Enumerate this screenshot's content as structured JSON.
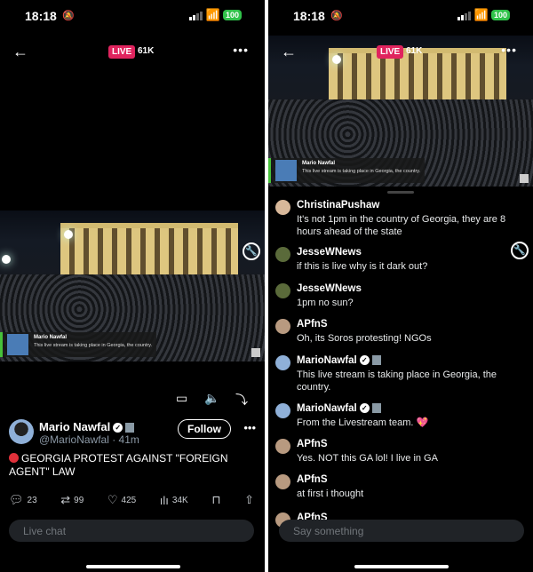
{
  "status": {
    "time": "18:18",
    "battery": "100"
  },
  "left": {
    "nav": {
      "live_label": "LIVE",
      "viewers": "61K"
    },
    "video_overlay": {
      "name": "Mario Nawfal",
      "text": "This live stream is taking place in Georgia, the country."
    },
    "author": {
      "name": "Mario Nawfal",
      "handle": "@MarioNawfal · 41m",
      "follow_label": "Follow"
    },
    "tweet_text": "GEORGIA PROTEST AGAINST \"FOREIGN AGENT\" LAW",
    "actions": {
      "replies": "23",
      "reposts": "99",
      "likes": "425",
      "views": "34K"
    },
    "chat_placeholder": "Live chat"
  },
  "right": {
    "nav": {
      "live_label": "LIVE",
      "viewers": "61K"
    },
    "video_overlay": {
      "name": "Mario Nawfal",
      "text": "This live stream is taking place in Georgia, the country."
    },
    "comments": [
      {
        "name": "ChristinaPushaw",
        "text": "It's not 1pm in the country of Georgia, they are 8 hours ahead of the state",
        "avatar_color": "#d8b89a"
      },
      {
        "name": "JesseWNews",
        "text": "if this is live why is it dark out?",
        "avatar_color": "#5a6a3a"
      },
      {
        "name": "JesseWNews",
        "text": "1pm no sun?",
        "avatar_color": "#5a6a3a"
      },
      {
        "name": "APfnS",
        "text": "Oh, its Soros protesting! NGOs",
        "avatar_color": "#b89a80"
      },
      {
        "name": "MarioNawfal",
        "text": "This live stream is taking place in Georgia, the country.",
        "avatar_color": "#8fb0d8",
        "verified": true
      },
      {
        "name": "MarioNawfal",
        "text": "From the Livestream team. 💖",
        "avatar_color": "#8fb0d8",
        "verified": true
      },
      {
        "name": "APfnS",
        "text": "Yes. NOT this GA lol! I live in GA",
        "avatar_color": "#b89a80"
      },
      {
        "name": "APfnS",
        "text": "at first i thought",
        "avatar_color": "#b89a80"
      },
      {
        "name": "APfnS",
        "text": "",
        "avatar_color": "#b89a80"
      }
    ],
    "chat_placeholder": "Say something"
  },
  "colors": {
    "live": "#e0245e",
    "battery": "#30c24a",
    "background": "#000000"
  }
}
